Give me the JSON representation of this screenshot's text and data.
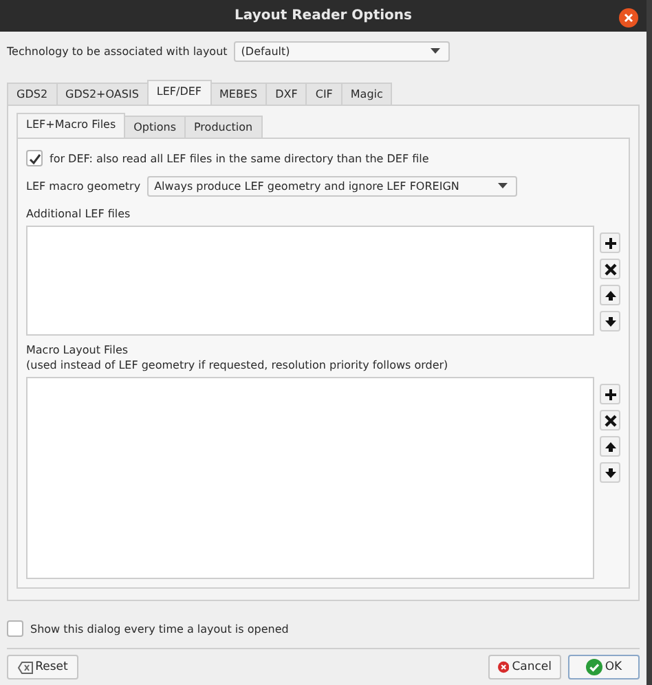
{
  "window": {
    "title": "Layout Reader Options"
  },
  "technology": {
    "label": "Technology to be associated with layout",
    "value": "(Default)"
  },
  "tabs": [
    {
      "label": "GDS2",
      "selected": false
    },
    {
      "label": "GDS2+OASIS",
      "selected": false
    },
    {
      "label": "LEF/DEF",
      "selected": true
    },
    {
      "label": "MEBES",
      "selected": false
    },
    {
      "label": "DXF",
      "selected": false
    },
    {
      "label": "CIF",
      "selected": false
    },
    {
      "label": "Magic",
      "selected": false
    }
  ],
  "subtabs": [
    {
      "label": "LEF+Macro Files",
      "selected": true
    },
    {
      "label": "Options",
      "selected": false
    },
    {
      "label": "Production",
      "selected": false
    }
  ],
  "read_lef_option": {
    "label": "for DEF: also read all LEF files in the same directory than the DEF file",
    "checked": true
  },
  "macro_geometry": {
    "label": "LEF macro geometry",
    "value": "Always produce LEF geometry and ignore LEF FOREIGN"
  },
  "lists": [
    {
      "title": "Additional LEF files"
    },
    {
      "title": "Macro Layout Files",
      "subtitle": "(used instead of LEF geometry if requested, resolution priority follows order)"
    }
  ],
  "show_dialog_option": {
    "label": "Show this dialog every time a layout is opened",
    "checked": false
  },
  "buttons": [
    {
      "kind": "reset",
      "label": "Reset"
    },
    {
      "kind": "cancel",
      "label": "Cancel"
    },
    {
      "kind": "ok",
      "label": "OK"
    }
  ]
}
